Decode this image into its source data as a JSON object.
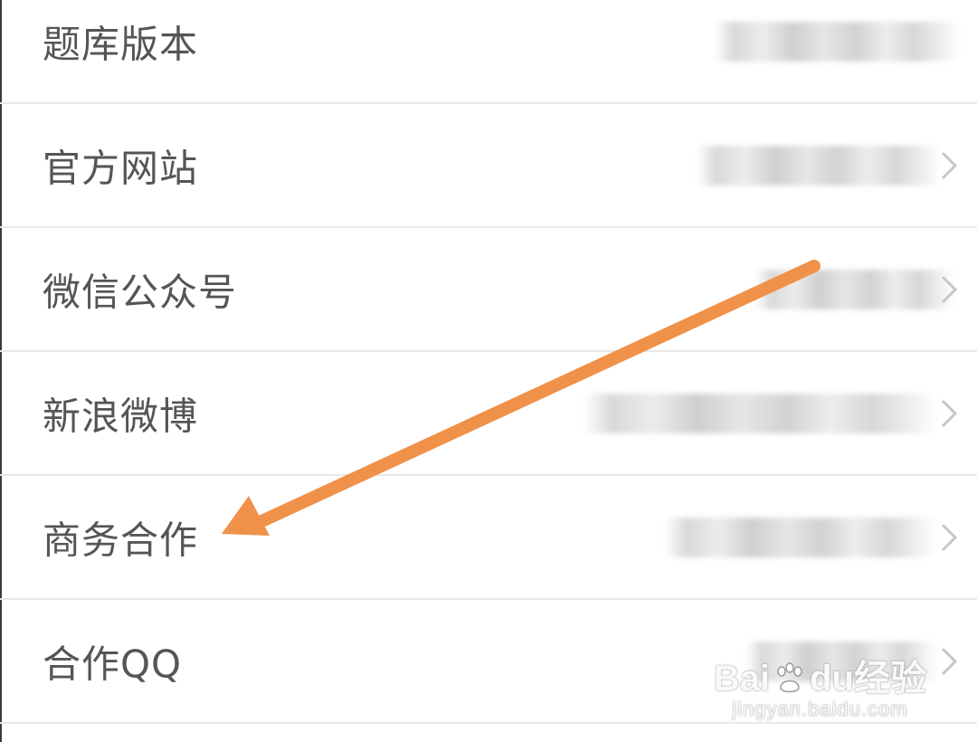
{
  "rows": [
    {
      "label": "题库版本"
    },
    {
      "label": "官方网站"
    },
    {
      "label": "微信公众号"
    },
    {
      "label": "新浪微博"
    },
    {
      "label": "商务合作"
    },
    {
      "label": "合作QQ"
    }
  ],
  "watermark": {
    "brand_left": "Bai",
    "brand_right": "du",
    "brand_cn": "经验",
    "url": "jingyan.baidu.com"
  },
  "colors": {
    "arrow": "#f0914a",
    "text": "#555555",
    "divider": "#e9e9e9"
  },
  "icons": {
    "row_chevron": "chevron-right-icon",
    "annotation": "arrow-icon",
    "watermark_logo": "baidu-paw-icon"
  }
}
